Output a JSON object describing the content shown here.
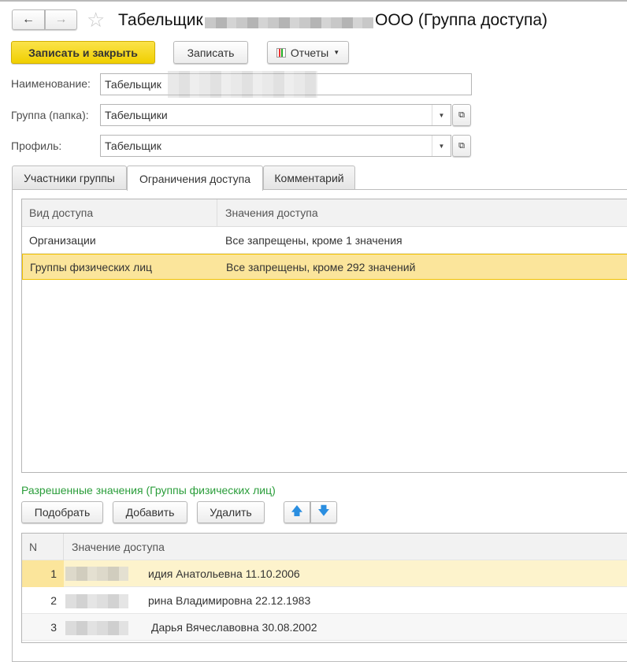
{
  "title": "Табельщик",
  "title_suffix": "ООО (Группа доступа)",
  "toolbar": {
    "save_close": "Записать и закрыть",
    "save": "Записать",
    "reports": "Отчеты"
  },
  "fields": [
    {
      "label": "Наименование:",
      "value": "Табельщик"
    },
    {
      "label": "Группа (папка):",
      "value": "Табельщики"
    },
    {
      "label": "Профиль:",
      "value": "Табельщик"
    }
  ],
  "tabs": [
    "Участники группы",
    "Ограничения доступа",
    "Комментарий"
  ],
  "access_table": {
    "headers": [
      "Вид доступа",
      "Значения доступа"
    ],
    "rows": [
      [
        "Организации",
        "Все запрещены, кроме 1 значения"
      ],
      [
        "Группы физических лиц",
        "Все запрещены, кроме 292 значений"
      ]
    ]
  },
  "allowed": {
    "title": "Разрешенные значения (Группы физических лиц)",
    "buttons": [
      "Подобрать",
      "Добавить",
      "Удалить"
    ],
    "headers": [
      "N",
      "Значение доступа"
    ],
    "rows": [
      [
        "1",
        "идия Анатольевна 11.10.2006"
      ],
      [
        "2",
        "рина Владимировна 22.12.1983"
      ],
      [
        "3",
        "Дарья Вячеславовна 30.08.2002"
      ]
    ]
  },
  "colors": {
    "accent": "#f5d90a",
    "selected": "#fbe59b",
    "green": "#2a9d3a"
  }
}
